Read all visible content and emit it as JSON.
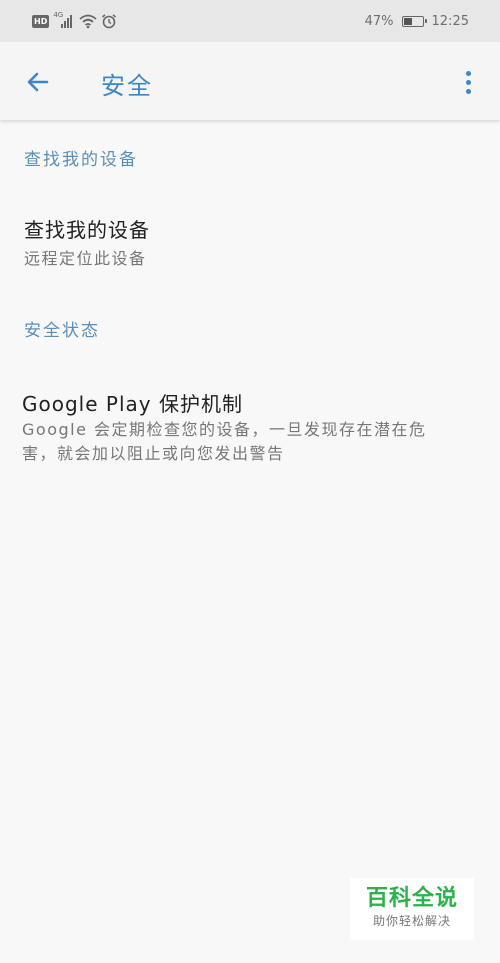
{
  "status_bar": {
    "hd_label": "HD",
    "network_label": "4G",
    "battery_text": "47%",
    "battery_level": 0.47,
    "time": "12:25",
    "icons": [
      "hd-icon",
      "signal-icon",
      "wifi-icon",
      "alarm-icon",
      "battery-icon"
    ]
  },
  "app_bar": {
    "title": "安全",
    "back_icon": "arrow-left-icon",
    "menu_icon": "more-vert-icon",
    "accent_color": "#3e86c6"
  },
  "sections": [
    {
      "header": "查找我的设备",
      "items": [
        {
          "title": "查找我的设备",
          "summary_lines": [
            "远程定位此设备"
          ]
        }
      ]
    },
    {
      "header": "安全状态",
      "items": [
        {
          "title": "Google Play 保护机制",
          "summary_lines": [
            "Google 会定期检查您的设备，一旦发现存在潜在危",
            "害，就会加以阻止或向您发出警告"
          ]
        }
      ]
    }
  ],
  "watermark": {
    "main": "百科全说",
    "sub": "助你轻松解决",
    "color": "#2bb24c"
  }
}
